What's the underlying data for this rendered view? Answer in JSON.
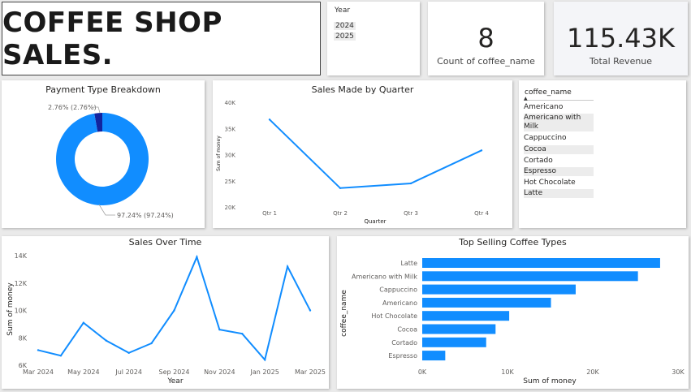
{
  "header": {
    "title": "COFFEE SHOP SALES."
  },
  "year_slicer": {
    "title": "Year",
    "options": [
      "2024",
      "2025"
    ]
  },
  "kpi_count": {
    "value": "8",
    "label": "Count of coffee_name"
  },
  "kpi_revenue": {
    "value": "115.43K",
    "label": "Total Revenue"
  },
  "coffee_slicer": {
    "title": "coffee_name",
    "sort_glyph": "▲",
    "items": [
      "Americano",
      "Americano with Milk",
      "Cappuccino",
      "Cocoa",
      "Cortado",
      "Espresso",
      "Hot Chocolate",
      "Latte"
    ]
  },
  "colors": {
    "accent": "#118DFF",
    "dark": "#12239E"
  },
  "chart_data": [
    {
      "id": "payment",
      "type": "pie",
      "title": "Payment Type Breakdown",
      "slices": [
        {
          "value": 97.24,
          "label": "97.24% (97.24%)",
          "color": "#118DFF"
        },
        {
          "value": 2.76,
          "label": "2.76% (2.76%)",
          "color": "#12239E"
        }
      ]
    },
    {
      "id": "quarter",
      "type": "line",
      "title": "Sales Made by Quarter",
      "xlabel": "Quarter",
      "ylabel": "Sum of money",
      "categories": [
        "Qtr 1",
        "Qtr 2",
        "Qtr 3",
        "Qtr 4"
      ],
      "values": [
        36700,
        23600,
        24500,
        30800
      ],
      "ylim": [
        20000,
        40000
      ],
      "yticks": [
        20000,
        25000,
        30000,
        35000,
        40000
      ],
      "ytick_labels": [
        "20K",
        "25K",
        "30K",
        "35K",
        "40K"
      ]
    },
    {
      "id": "time",
      "type": "line",
      "title": "Sales Over Time",
      "xlabel": "Year",
      "ylabel": "Sum of money",
      "x": [
        "2024-03",
        "2024-04",
        "2024-05",
        "2024-06",
        "2024-07",
        "2024-08",
        "2024-09",
        "2024-10",
        "2024-11",
        "2024-12",
        "2025-01",
        "2025-02",
        "2025-03"
      ],
      "values": [
        7100,
        6700,
        9100,
        7800,
        6900,
        7600,
        10000,
        13900,
        8600,
        8300,
        6400,
        13200,
        10000
      ],
      "ylim": [
        6000,
        14000
      ],
      "yticks": [
        6000,
        8000,
        10000,
        12000,
        14000
      ],
      "ytick_labels": [
        "6K",
        "8K",
        "10K",
        "12K",
        "14K"
      ],
      "xtick_labels": [
        "Mar 2024",
        "May 2024",
        "Jul 2024",
        "Sep 2024",
        "Nov 2024",
        "Jan 2025",
        "Mar 2025"
      ]
    },
    {
      "id": "top",
      "type": "bar",
      "orientation": "horizontal",
      "title": "Top Selling Coffee Types",
      "xlabel": "Sum of money",
      "ylabel": "coffee_name",
      "categories": [
        "Latte",
        "Americano with Milk",
        "Cappuccino",
        "Americano",
        "Hot Chocolate",
        "Cocoa",
        "Cortado",
        "Espresso"
      ],
      "values": [
        27900,
        25300,
        18000,
        15100,
        10200,
        8600,
        7500,
        2700
      ],
      "xlim": [
        0,
        30000
      ],
      "xticks": [
        0,
        10000,
        20000,
        30000
      ],
      "xtick_labels": [
        "0K",
        "10K",
        "20K",
        "30K"
      ]
    }
  ]
}
